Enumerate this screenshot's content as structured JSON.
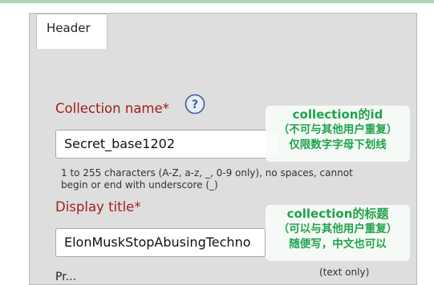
{
  "header_tab": {
    "label": "Header"
  },
  "collection_name": {
    "label": "Collection name*",
    "value": "Secret_base1202",
    "hint": "1 to 255 characters (A-Z, a-z, _, 0-9 only), no spaces, cannot begin or end with underscore (_)"
  },
  "display_title": {
    "label": "Display title*",
    "value": "ElonMuskStopAbusingTechno"
  },
  "annotations": {
    "name_note": [
      "collection的id",
      "（不可与其他用户重复）",
      "仅限数字字母下划线"
    ],
    "title_note": [
      "collection的标题",
      "（可以与其他用户重复）",
      "随便写，中文也可以"
    ]
  },
  "text_only_label": "(text only)",
  "next_label_cutoff": "Pr..."
}
